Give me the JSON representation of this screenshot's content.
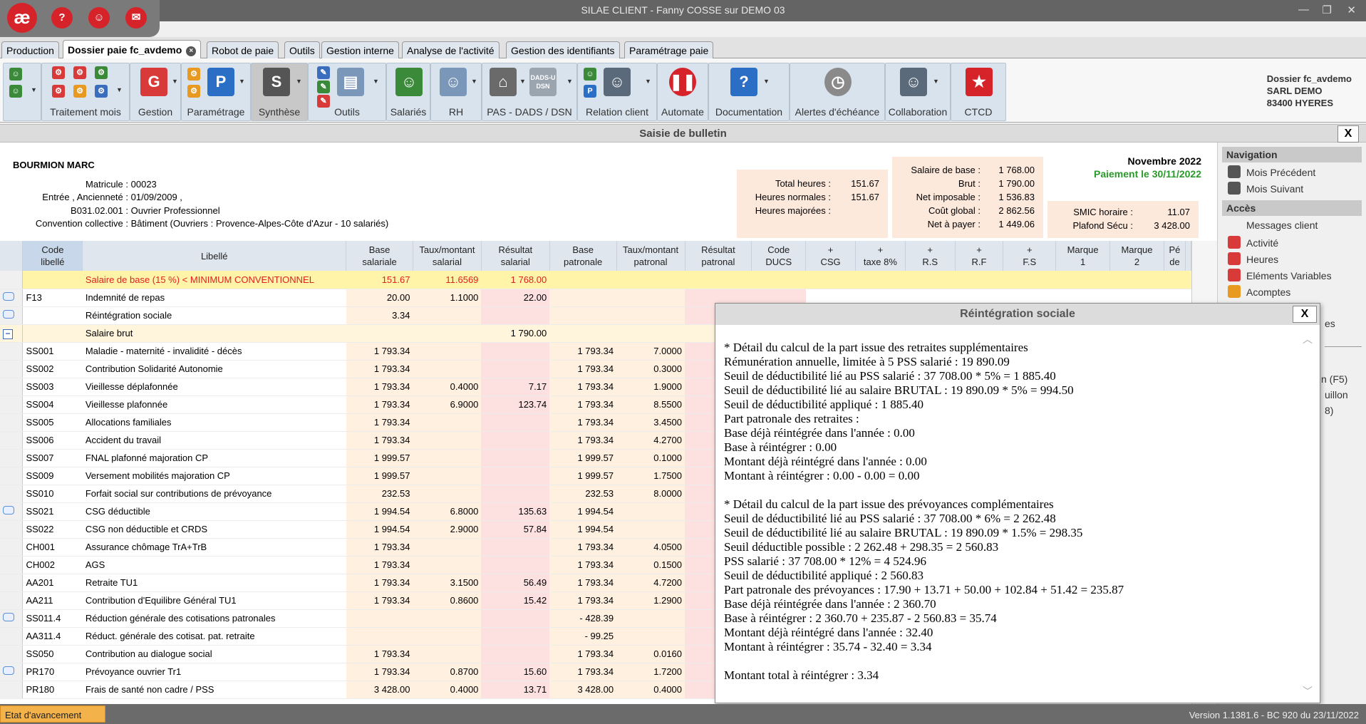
{
  "window": {
    "title": "SILAE CLIENT - Fanny COSSE sur DEMO 03"
  },
  "logo": {
    "text": "æ"
  },
  "quick_buttons": [
    "?",
    "☺",
    "✉"
  ],
  "tabs": [
    "Production",
    "Dossier paie fc_avdemo",
    "Robot de paie",
    "Outils",
    "Gestion interne",
    "Analyse de l'activité",
    "Gestion des identifiants",
    "Paramétrage paie"
  ],
  "ribbon": {
    "groups": [
      "Traitement mois",
      "Gestion",
      "Paramétrage",
      "Synthèse",
      "Outils",
      "Salariés",
      "RH",
      "PAS - DADS / DSN",
      "Relation client",
      "Automate",
      "Documentation",
      "Alertes d'échéance",
      "Collaboration",
      "CTCD"
    ],
    "dads_label": "DADS-U DSN"
  },
  "dossier": {
    "line1": "Dossier fc_avdemo",
    "line2": "SARL DEMO",
    "line3": "83400 HYERES"
  },
  "saisie": {
    "title": "Saisie de bulletin",
    "close": "X"
  },
  "employee": {
    "name": "BOURMION MARC",
    "matricule_label": "Matricule :",
    "matricule": "00023",
    "entree_label": "Entrée , Ancienneté :",
    "entree": "01/09/2009   ,",
    "emploi_code": "B031.02.001 :",
    "emploi": "Ouvrier Professionnel",
    "convention_label": "Convention collective :",
    "convention": "Bâtiment (Ouvriers : Provence-Alpes-Côte d'Azur - 10 salariés)"
  },
  "hours": {
    "total_label": "Total heures :",
    "total": "151.67",
    "normales_label": "Heures normales :",
    "normales": "151.67",
    "majorees_label": "Heures majorées :",
    "majorees": ""
  },
  "salary": {
    "base_label": "Salaire de base :",
    "base": "1 768.00",
    "brut_label": "Brut :",
    "brut": "1 790.00",
    "net_imposable_label": "Net imposable :",
    "net_imposable": "1 536.83",
    "cout_label": "Coût global :",
    "cout": "2 862.56",
    "net_label": "Net à payer :",
    "net": "1 449.06"
  },
  "smic": {
    "smic_label": "SMIC horaire :",
    "smic": "11.07",
    "plafond_label": "Plafond Sécu :",
    "plafond": "3 428.00"
  },
  "period": {
    "month": "Novembre 2022",
    "payment": "Paiement le 30/11/2022"
  },
  "grid": {
    "headers": [
      "Code\nlibellé",
      "Libellé",
      "Base\nsalariale",
      "Taux/montant\nsalarial",
      "Résultat\nsalarial",
      "Base\npatronale",
      "Taux/montant\npatronal",
      "Résultat\npatronal",
      "Code\nDUCS",
      "+\nCSG",
      "+\ntaxe 8%",
      "+\nR.S",
      "+\nR.F",
      "+\nF.S",
      "Marque\n1",
      "Marque\n2",
      "Pé\nde"
    ],
    "rows": [
      {
        "code": "",
        "lib": "Salaire de base (15 %) < MINIMUM CONVENTIONNEL",
        "bs": "151.67",
        "ts": "11.6569",
        "rs": "1 768.00",
        "bp": "",
        "tp": "",
        "rp": "",
        "kind": "yellow",
        "icon": ""
      },
      {
        "code": "F13",
        "lib": "Indemnité de repas",
        "bs": "20.00",
        "ts": "1.1000",
        "rs": "22.00",
        "bp": "",
        "tp": "",
        "rp": "",
        "kind": "",
        "icon": "msg"
      },
      {
        "code": "",
        "lib": "Réintégration sociale",
        "bs": "3.34",
        "ts": "",
        "rs": "",
        "bp": "",
        "tp": "",
        "rp": "",
        "kind": "",
        "icon": "msg"
      },
      {
        "code": "",
        "lib": "Salaire brut",
        "bs": "",
        "ts": "",
        "rs": "1 790.00",
        "bp": "",
        "tp": "",
        "rp": "",
        "kind": "brut",
        "icon": "minus"
      },
      {
        "code": "SS001",
        "lib": "Maladie - maternité - invalidité - décès",
        "bs": "1 793.34",
        "ts": "",
        "rs": "",
        "bp": "1 793.34",
        "tp": "7.0000",
        "rp": "",
        "kind": "",
        "icon": ""
      },
      {
        "code": "SS002",
        "lib": "Contribution Solidarité Autonomie",
        "bs": "1 793.34",
        "ts": "",
        "rs": "",
        "bp": "1 793.34",
        "tp": "0.3000",
        "rp": "",
        "kind": "",
        "icon": ""
      },
      {
        "code": "SS003",
        "lib": "Vieillesse déplafonnée",
        "bs": "1 793.34",
        "ts": "0.4000",
        "rs": "7.17",
        "bp": "1 793.34",
        "tp": "1.9000",
        "rp": "",
        "kind": "",
        "icon": ""
      },
      {
        "code": "SS004",
        "lib": "Vieillesse plafonnée",
        "bs": "1 793.34",
        "ts": "6.9000",
        "rs": "123.74",
        "bp": "1 793.34",
        "tp": "8.5500",
        "rp": "",
        "kind": "",
        "icon": ""
      },
      {
        "code": "SS005",
        "lib": "Allocations familiales",
        "bs": "1 793.34",
        "ts": "",
        "rs": "",
        "bp": "1 793.34",
        "tp": "3.4500",
        "rp": "",
        "kind": "",
        "icon": ""
      },
      {
        "code": "SS006",
        "lib": "Accident du travail",
        "bs": "1 793.34",
        "ts": "",
        "rs": "",
        "bp": "1 793.34",
        "tp": "4.2700",
        "rp": "",
        "kind": "",
        "icon": ""
      },
      {
        "code": "SS007",
        "lib": "FNAL plafonné majoration CP",
        "bs": "1 999.57",
        "ts": "",
        "rs": "",
        "bp": "1 999.57",
        "tp": "0.1000",
        "rp": "",
        "kind": "",
        "icon": ""
      },
      {
        "code": "SS009",
        "lib": "Versement mobilités majoration CP",
        "bs": "1 999.57",
        "ts": "",
        "rs": "",
        "bp": "1 999.57",
        "tp": "1.7500",
        "rp": "",
        "kind": "",
        "icon": ""
      },
      {
        "code": "SS010",
        "lib": "Forfait social sur contributions de prévoyance",
        "bs": "232.53",
        "ts": "",
        "rs": "",
        "bp": "232.53",
        "tp": "8.0000",
        "rp": "",
        "kind": "",
        "icon": ""
      },
      {
        "code": "SS021",
        "lib": "CSG déductible",
        "bs": "1 994.54",
        "ts": "6.8000",
        "rs": "135.63",
        "bp": "1 994.54",
        "tp": "",
        "rp": "",
        "kind": "",
        "icon": "msg"
      },
      {
        "code": "SS022",
        "lib": "CSG non déductible et CRDS",
        "bs": "1 994.54",
        "ts": "2.9000",
        "rs": "57.84",
        "bp": "1 994.54",
        "tp": "",
        "rp": "",
        "kind": "",
        "icon": ""
      },
      {
        "code": "CH001",
        "lib": "Assurance chômage TrA+TrB",
        "bs": "1 793.34",
        "ts": "",
        "rs": "",
        "bp": "1 793.34",
        "tp": "4.0500",
        "rp": "",
        "kind": "",
        "icon": ""
      },
      {
        "code": "CH002",
        "lib": "AGS",
        "bs": "1 793.34",
        "ts": "",
        "rs": "",
        "bp": "1 793.34",
        "tp": "0.1500",
        "rp": "",
        "kind": "",
        "icon": ""
      },
      {
        "code": "AA201",
        "lib": "Retraite TU1",
        "bs": "1 793.34",
        "ts": "3.1500",
        "rs": "56.49",
        "bp": "1 793.34",
        "tp": "4.7200",
        "rp": "",
        "kind": "",
        "icon": ""
      },
      {
        "code": "AA211",
        "lib": "Contribution d'Equilibre Général TU1",
        "bs": "1 793.34",
        "ts": "0.8600",
        "rs": "15.42",
        "bp": "1 793.34",
        "tp": "1.2900",
        "rp": "",
        "kind": "",
        "icon": ""
      },
      {
        "code": "SS011.4",
        "lib": "Réduction générale des cotisations patronales",
        "bs": "",
        "ts": "",
        "rs": "",
        "bp": "- 428.39",
        "tp": "",
        "rp": "",
        "kind": "",
        "icon": "msg"
      },
      {
        "code": "AA311.4",
        "lib": "Réduct. générale des cotisat. pat. retraite",
        "bs": "",
        "ts": "",
        "rs": "",
        "bp": "- 99.25",
        "tp": "",
        "rp": "",
        "kind": "",
        "icon": ""
      },
      {
        "code": "SS050",
        "lib": "Contribution au dialogue social",
        "bs": "1 793.34",
        "ts": "",
        "rs": "",
        "bp": "1 793.34",
        "tp": "0.0160",
        "rp": "",
        "kind": "",
        "icon": ""
      },
      {
        "code": "PR170",
        "lib": "Prévoyance ouvrier Tr1",
        "bs": "1 793.34",
        "ts": "0.8700",
        "rs": "15.60",
        "bp": "1 793.34",
        "tp": "1.7200",
        "rp": "",
        "kind": "",
        "icon": "msg"
      },
      {
        "code": "PR180",
        "lib": "Frais de santé non cadre / PSS",
        "bs": "3 428.00",
        "ts": "0.4000",
        "rs": "13.71",
        "bp": "3 428.00",
        "tp": "0.4000",
        "rp": "",
        "kind": "",
        "icon": ""
      }
    ]
  },
  "navigation": {
    "title": "Navigation",
    "items": [
      "Mois Précédent",
      "Mois Suivant"
    ],
    "acces_title": "Accès",
    "acces_items": [
      "Messages client",
      "Activité",
      "Heures",
      "Eléments Variables",
      "Acomptes"
    ],
    "hidden_fragments": [
      "es",
      "n (F5)",
      "uillon",
      "8)"
    ]
  },
  "popup": {
    "title": "Réintégration sociale",
    "close": "X",
    "lines": [
      "* Détail du calcul de la part issue des retraites supplémentaires",
      "Rémunération annuelle, limitée à 5 PSS salarié : 19 890.09",
      "Seuil de déductibilité lié au PSS salarié : 37 708.00 * 5% = 1 885.40",
      "Seuil de déductibilité lié au salaire BRUTAL : 19 890.09 * 5% = 994.50",
      "Seuil de déductibilité appliqué : 1 885.40",
      "Part patronale des retraites :",
      "Base déjà réintégrée dans l'année : 0.00",
      "Base à réintégrer : 0.00",
      "Montant déjà réintégré dans l'année : 0.00",
      "Montant à réintégrer : 0.00 - 0.00 = 0.00",
      "",
      "* Détail du calcul de la part issue des prévoyances complémentaires",
      "Seuil de déductibilité lié au PSS salarié : 37 708.00 * 6% = 2 262.48",
      "Seuil de déductibilité lié au salaire BRUTAL : 19 890.09 * 1.5% = 298.35",
      "Seuil déductible possible : 2 262.48 + 298.35 = 2 560.83",
      "PSS salarié : 37 708.00 * 12% = 4 524.96",
      "Seuil de déductibilité appliqué : 2 560.83",
      "Part patronale des prévoyances : 17.90 + 13.71 + 50.00 + 102.84 + 51.42 = 235.87",
      "Base déjà réintégrée dans l'année : 2 360.70",
      "Base à réintégrer : 2 360.70 + 235.87 - 2 560.83 = 35.74",
      "Montant déjà réintégré dans l'année : 32.40",
      "Montant à réintégrer : 35.74 - 32.40 = 3.34",
      "",
      "Montant total à réintégrer : 3.34"
    ]
  },
  "status": {
    "etat": "Etat d'avancement",
    "version": "Version 1.1381.6 - BC 920 du 23/11/2022"
  }
}
